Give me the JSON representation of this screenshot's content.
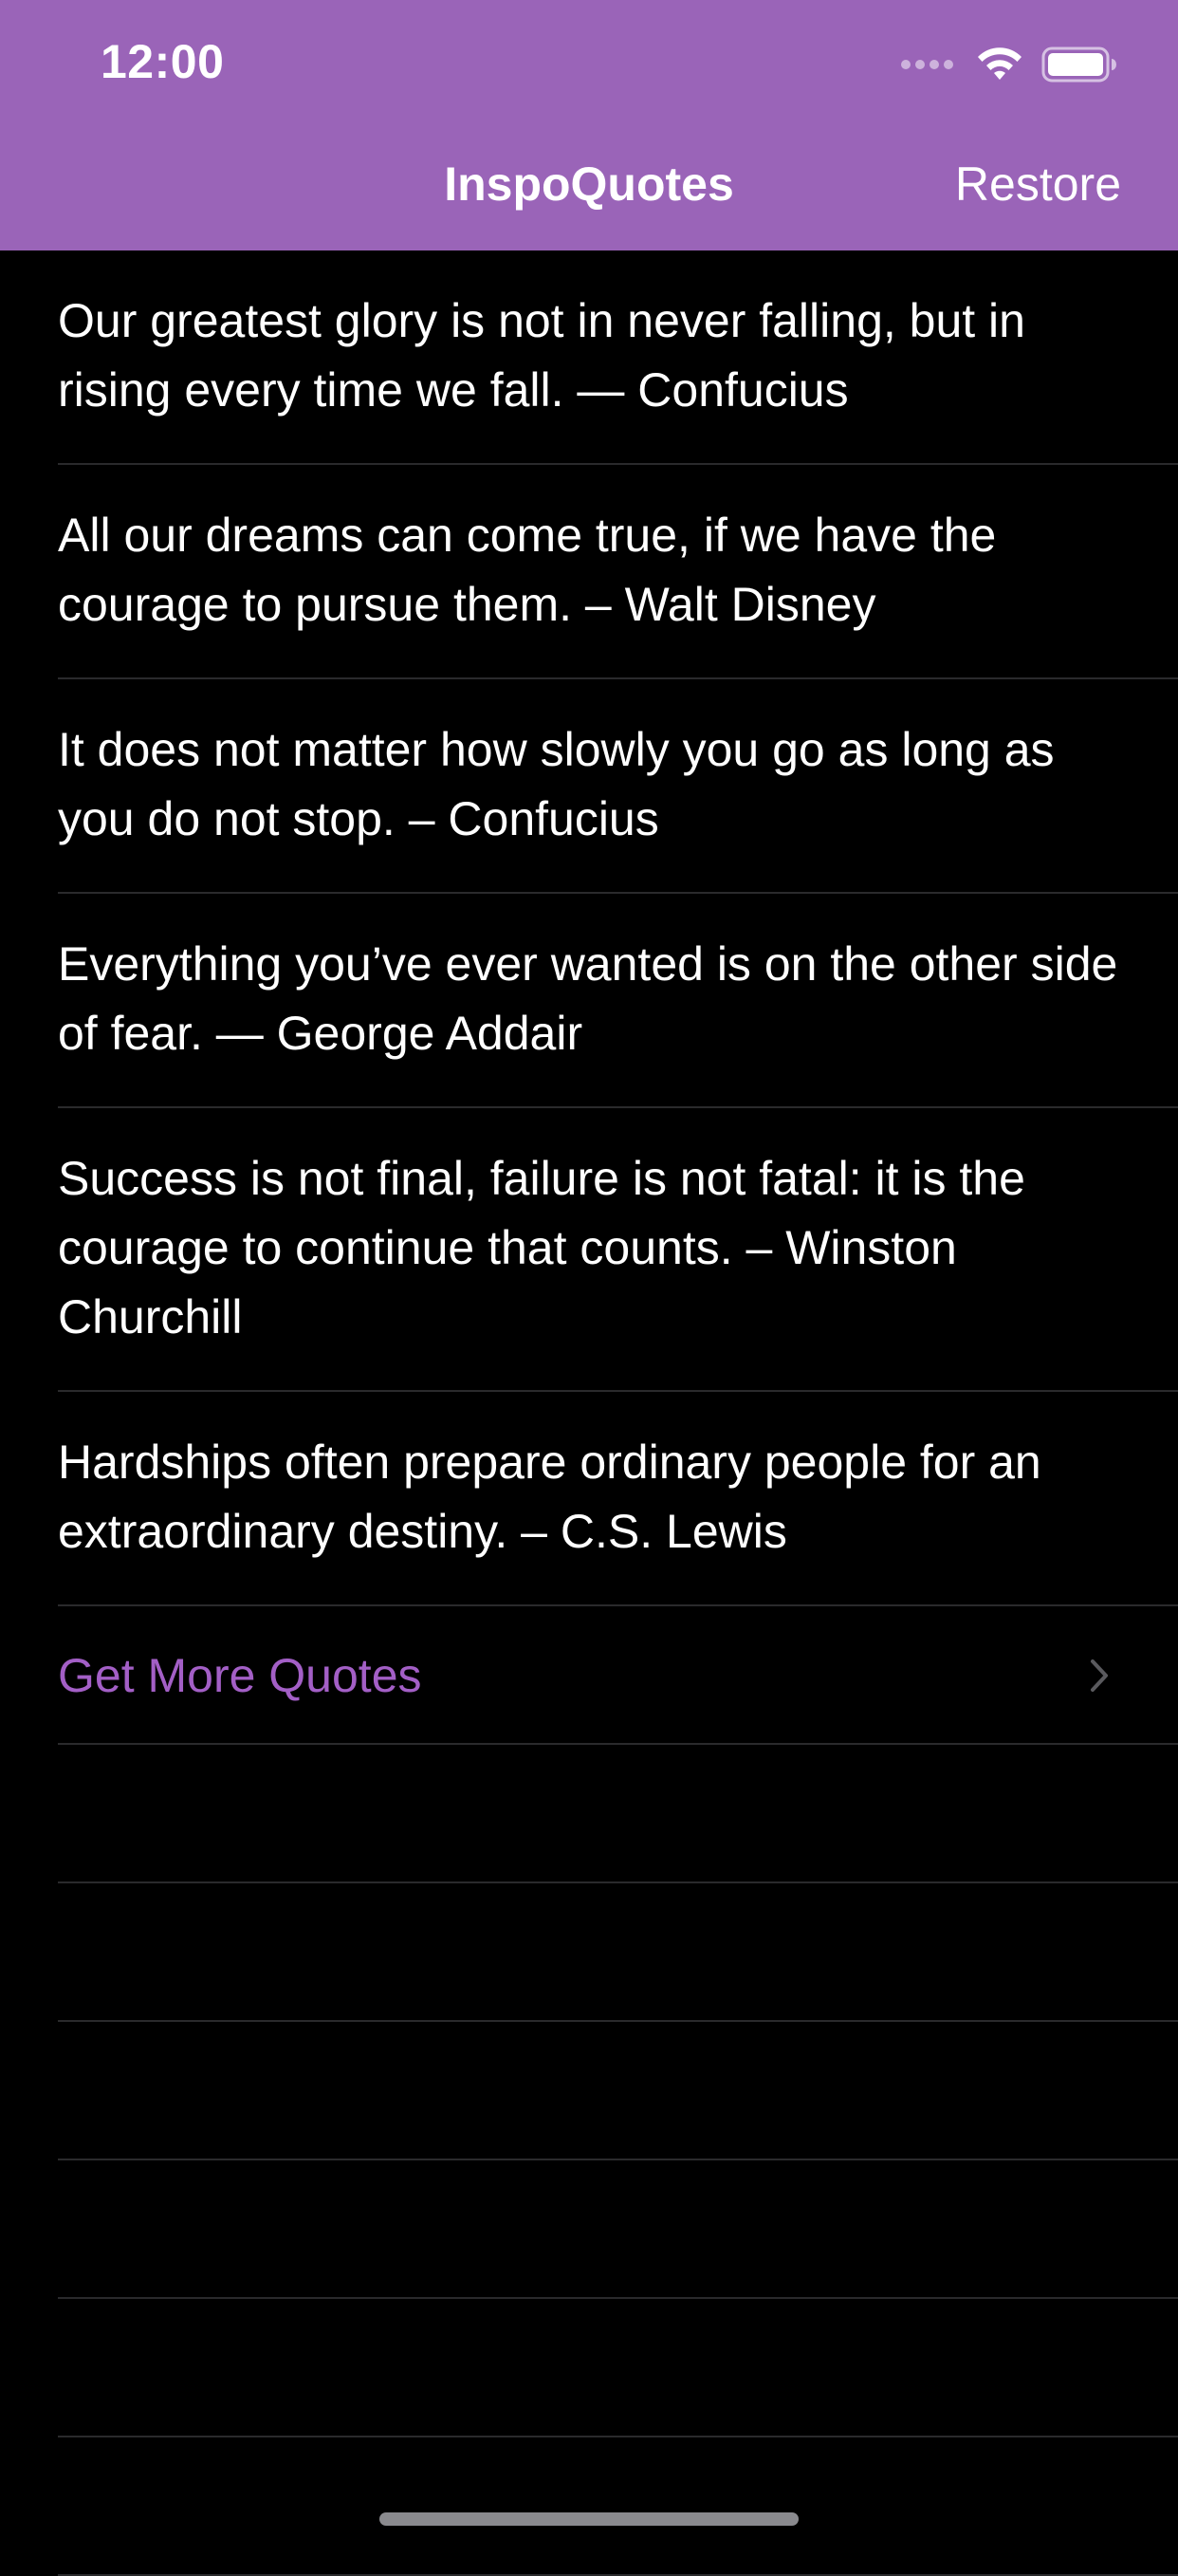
{
  "status_bar": {
    "time": "12:00"
  },
  "nav": {
    "title": "InspoQuotes",
    "restore_label": "Restore"
  },
  "colors": {
    "header_bg": "#9A64B8",
    "accent": "#A35FC6",
    "background": "#000000"
  },
  "quotes": [
    "Our greatest glory is not in never falling, but in rising every time we fall. — Confucius",
    "All our dreams can come true, if we have the courage to pursue them. – Walt Disney",
    "It does not matter how slowly you go as long as you do not stop. – Confucius",
    "Everything you’ve ever wanted is on the other side of fear. — George Addair",
    "Success is not final, failure is not fatal: it is the courage to continue that counts. – Winston Churchill",
    "Hardships often prepare ordinary people for an extraordinary destiny. – C.S. Lewis"
  ],
  "more_row": {
    "label": "Get More Quotes",
    "icon": "chevron-right-icon"
  }
}
